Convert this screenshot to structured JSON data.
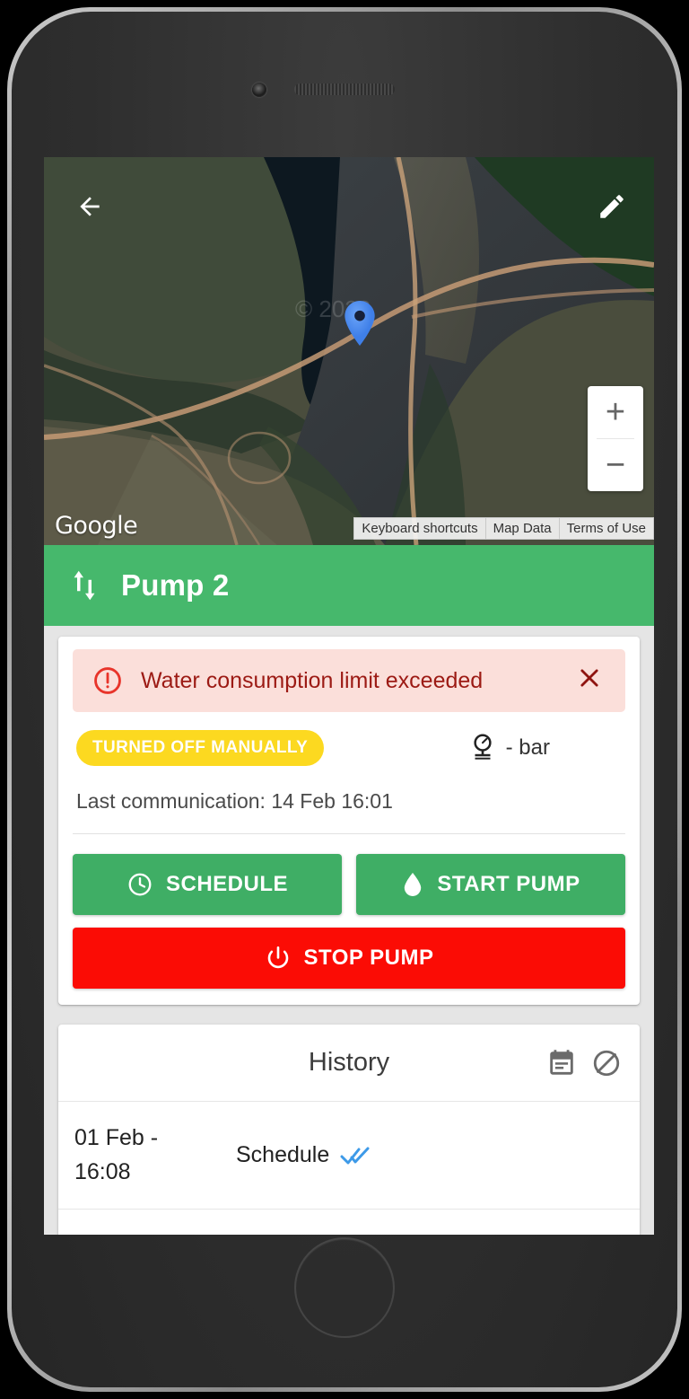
{
  "map": {
    "back_icon": "arrow-left-icon",
    "edit_icon": "pencil-icon",
    "zoom_in_label": "+",
    "zoom_out_label": "−",
    "google_logo": "Google",
    "attribution": [
      "Keyboard shortcuts",
      "Map Data",
      "Terms of Use"
    ],
    "marker_color": "#4285f4"
  },
  "titlebar": {
    "icon": "arrows-up-down-icon",
    "title": "Pump 2",
    "color": "#46b86c"
  },
  "alert": {
    "icon": "error-circle-icon",
    "message": "Water consumption limit exceeded",
    "close_icon": "close-icon",
    "background": "#fbdfda",
    "text_color": "#9c1a14"
  },
  "status": {
    "badge": "TURNED OFF MANUALLY",
    "badge_color": "#fcd920",
    "pressure_icon": "pressure-gauge-icon",
    "pressure_value": "- bar",
    "last_communication": "Last communication: 14 Feb 16:01"
  },
  "actions": {
    "schedule": {
      "label": "SCHEDULE",
      "icon": "clock-icon",
      "color": "#3fae65"
    },
    "start_pump": {
      "label": "START PUMP",
      "icon": "water-drop-icon",
      "color": "#3fae65"
    },
    "stop_pump": {
      "label": "STOP PUMP",
      "icon": "power-icon",
      "color": "#fb0c05"
    }
  },
  "history": {
    "title": "History",
    "calendar_icon": "calendar-event-icon",
    "hide_icon": "hide-circle-slash-icon",
    "rows": [
      {
        "date": "01 Feb -",
        "time": "16:08",
        "action": "Schedule",
        "status_icon": "double-check-icon",
        "status_color": "#3d9ae8"
      }
    ]
  }
}
